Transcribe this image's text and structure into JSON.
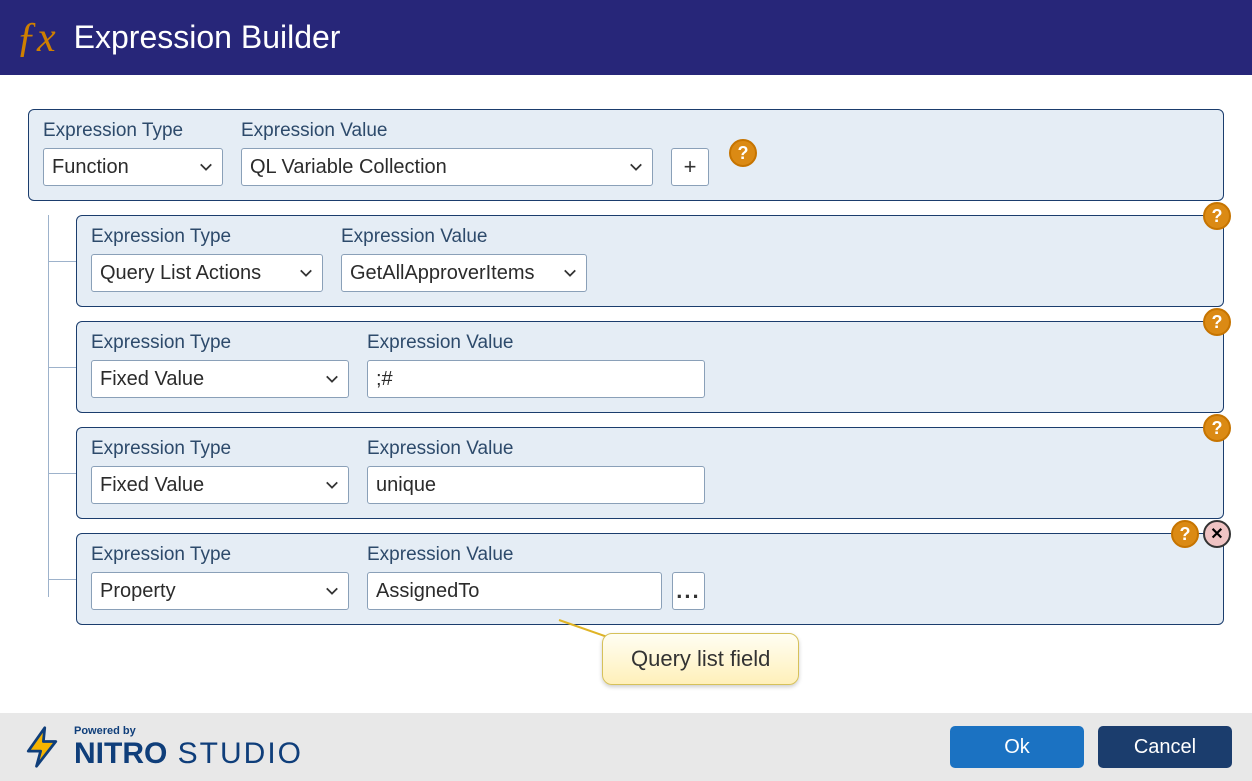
{
  "header": {
    "title": "Expression Builder"
  },
  "labels": {
    "type": "Expression Type",
    "value": "Expression Value"
  },
  "root": {
    "type": "Function",
    "value": "QL Variable Collection",
    "add_label": "+"
  },
  "children": [
    {
      "type": "Query List Actions",
      "type_w": 232,
      "value_kind": "select",
      "value": "GetAllApproverItems",
      "value_w": 246,
      "show_close": false
    },
    {
      "type": "Fixed Value",
      "type_w": 258,
      "value_kind": "text",
      "value": ";#",
      "value_w": 338,
      "show_close": false
    },
    {
      "type": "Fixed Value",
      "type_w": 258,
      "value_kind": "text",
      "value": "unique",
      "value_w": 338,
      "show_close": false
    },
    {
      "type": "Property",
      "type_w": 258,
      "value_kind": "pick",
      "value": "AssignedTo",
      "value_w": 338,
      "show_close": true,
      "pick_label": "..."
    }
  ],
  "callout": {
    "text": "Query list field"
  },
  "footer": {
    "powered_by": "Powered by",
    "brand_bold": "NITRO",
    "brand_light": " STUDIO",
    "ok": "Ok",
    "cancel": "Cancel"
  }
}
